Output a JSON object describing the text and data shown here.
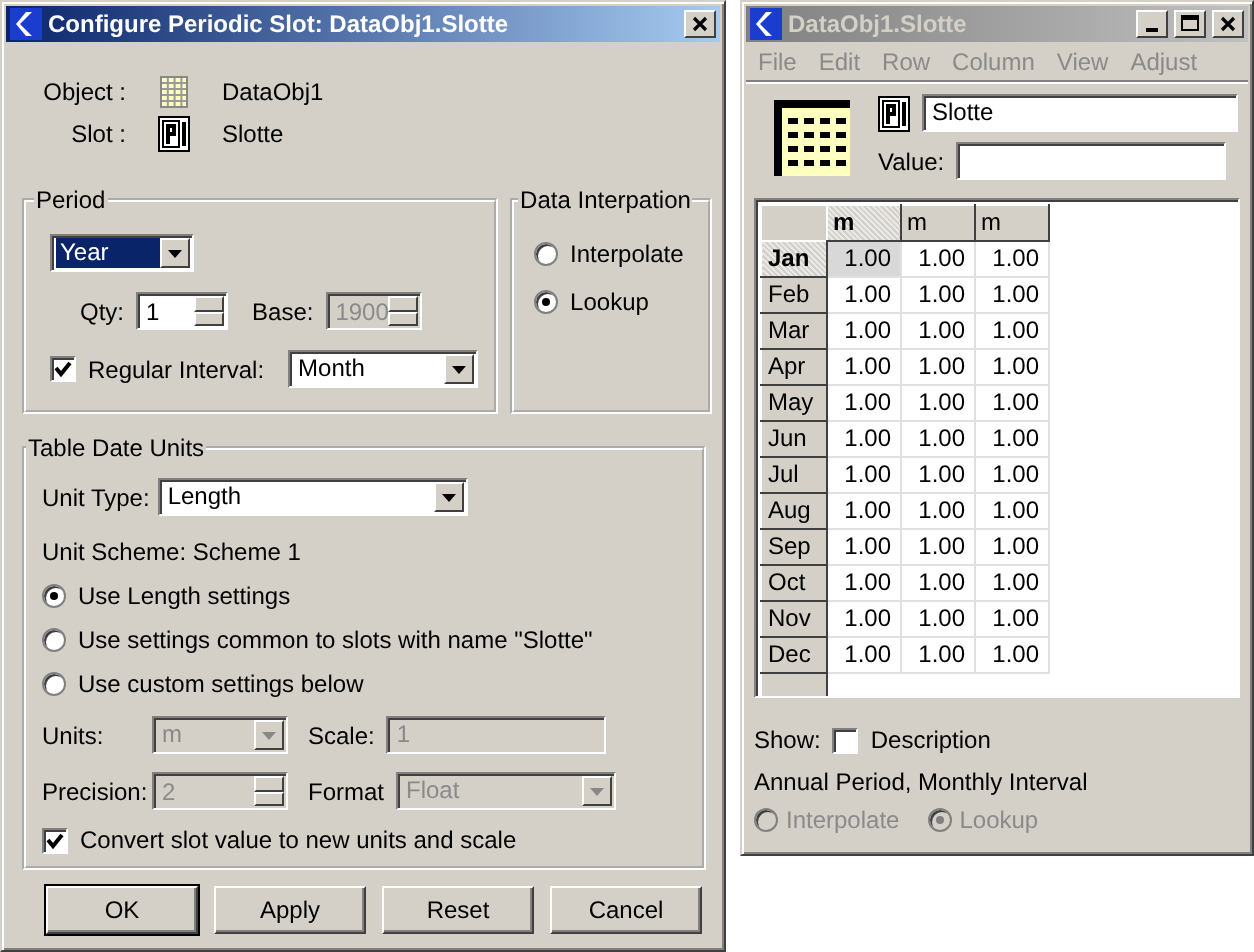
{
  "dialog": {
    "title": "Configure Periodic Slot: DataObj1.Slotte",
    "object": {
      "label": "Object :",
      "value": "DataObj1"
    },
    "slot": {
      "label": "Slot :",
      "value": "Slotte"
    },
    "period": {
      "legend": "Period",
      "unit": {
        "value": "Year",
        "highlighted": true
      },
      "qty": {
        "label": "Qty:",
        "value": "1",
        "disabled": false
      },
      "base": {
        "label": "Base:",
        "value": "1900",
        "disabled": true
      },
      "regular_interval": {
        "label": "Regular Interval:",
        "checked": true,
        "value": "Month"
      }
    },
    "data_interpolation": {
      "legend": "Data Interpation",
      "options": [
        {
          "label": "Interpolate",
          "selected": false
        },
        {
          "label": "Lookup",
          "selected": true
        }
      ]
    },
    "table_date_units": {
      "legend": "Table Date Units",
      "unit_type": {
        "label": "Unit Type:",
        "value": "Length"
      },
      "unit_scheme": "Unit Scheme: Scheme 1",
      "options": [
        {
          "label": "Use Length settings",
          "selected": true
        },
        {
          "label": "Use settings common to slots with name \"Slotte\"",
          "selected": false
        },
        {
          "label": "Use custom settings below",
          "selected": false
        }
      ],
      "units": {
        "label": "Units:",
        "value": "m",
        "disabled": true
      },
      "scale": {
        "label": "Scale:",
        "value": "1",
        "disabled": true
      },
      "precision": {
        "label": "Precision:",
        "value": "2",
        "disabled": true
      },
      "format": {
        "label": "Format",
        "value": "Float",
        "disabled": true
      },
      "convert": {
        "label": "Convert slot value to new units and scale",
        "checked": true
      }
    },
    "buttons": [
      "OK",
      "Apply",
      "Reset",
      "Cancel"
    ]
  },
  "slot_window": {
    "title": "DataObj1.Slotte",
    "menu": [
      {
        "label": "File",
        "disabled": true
      },
      {
        "label": "Edit",
        "disabled": true
      },
      {
        "label": "Row",
        "disabled": true
      },
      {
        "label": "Column",
        "disabled": true
      },
      {
        "label": "View",
        "disabled": true
      },
      {
        "label": "Adjust",
        "disabled": true
      }
    ],
    "slot_name": "Slotte",
    "value_label": "Value:",
    "table": {
      "columns": [
        {
          "label": "m",
          "selected": true
        },
        {
          "label": "m",
          "selected": false
        },
        {
          "label": "m",
          "selected": false
        }
      ],
      "rows": [
        {
          "label": "Jan",
          "selected": true,
          "values": [
            "1.00",
            "1.00",
            "1.00"
          ]
        },
        {
          "label": "Feb",
          "selected": false,
          "values": [
            "1.00",
            "1.00",
            "1.00"
          ]
        },
        {
          "label": "Mar",
          "selected": false,
          "values": [
            "1.00",
            "1.00",
            "1.00"
          ]
        },
        {
          "label": "Apr",
          "selected": false,
          "values": [
            "1.00",
            "1.00",
            "1.00"
          ]
        },
        {
          "label": "May",
          "selected": false,
          "values": [
            "1.00",
            "1.00",
            "1.00"
          ]
        },
        {
          "label": "Jun",
          "selected": false,
          "values": [
            "1.00",
            "1.00",
            "1.00"
          ]
        },
        {
          "label": "Jul",
          "selected": false,
          "values": [
            "1.00",
            "1.00",
            "1.00"
          ]
        },
        {
          "label": "Aug",
          "selected": false,
          "values": [
            "1.00",
            "1.00",
            "1.00"
          ]
        },
        {
          "label": "Sep",
          "selected": false,
          "values": [
            "1.00",
            "1.00",
            "1.00"
          ]
        },
        {
          "label": "Oct",
          "selected": false,
          "values": [
            "1.00",
            "1.00",
            "1.00"
          ]
        },
        {
          "label": "Nov",
          "selected": false,
          "values": [
            "1.00",
            "1.00",
            "1.00"
          ]
        },
        {
          "label": "Dec",
          "selected": false,
          "values": [
            "1.00",
            "1.00",
            "1.00"
          ]
        }
      ]
    },
    "show": {
      "label": "Show:",
      "option": "Description",
      "checked": false
    },
    "summary": "Annual Period, Monthly Interval",
    "interpolation": {
      "disabled": true,
      "options": [
        {
          "label": "Interpolate",
          "selected": false
        },
        {
          "label": "Lookup",
          "selected": true
        }
      ]
    }
  }
}
